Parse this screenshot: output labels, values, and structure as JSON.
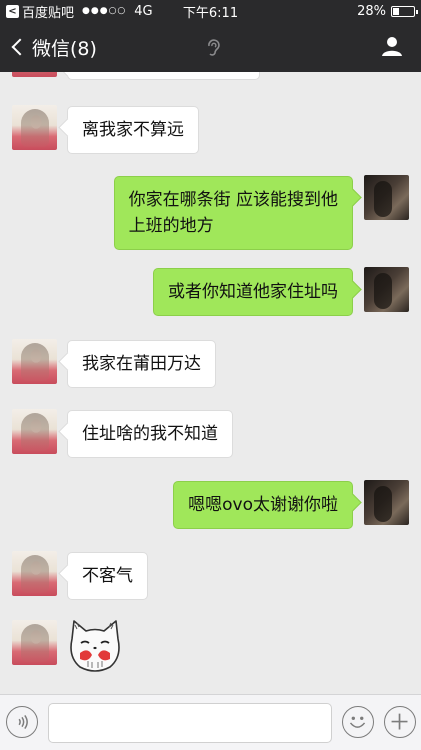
{
  "status_bar": {
    "back_app": "百度贴吧",
    "signal_dots": "●●●○○",
    "network": "4G",
    "time": "下午6:11",
    "battery_percent": "28%",
    "battery_level": 0.28
  },
  "nav": {
    "back_label": "微信(8)",
    "back_icon": "chevron-left-icon",
    "center_icon": "ear-icon",
    "right_icon": "person-icon"
  },
  "messages": [
    {
      "side": "in",
      "text": "离我家不算远"
    },
    {
      "side": "out",
      "text": "你家在哪条街 应该能搜到他\n上班的地方"
    },
    {
      "side": "out",
      "text": "或者你知道他家住址吗"
    },
    {
      "side": "in",
      "text": "我家在莆田万达"
    },
    {
      "side": "in",
      "text": "住址啥的我不知道"
    },
    {
      "side": "out",
      "text": "嗯嗯ovo太谢谢你啦"
    },
    {
      "side": "in",
      "text": "不客气"
    },
    {
      "side": "in",
      "sticker": "cat-sticker"
    }
  ],
  "colors": {
    "bar": "#2a2a2c",
    "chat_bg": "#ebebeb",
    "outgoing_bubble": "#a0e75a",
    "incoming_bubble": "#ffffff"
  },
  "input_bar": {
    "input_value": "",
    "left_icon": "voice-icon",
    "emoji_icon": "emoji-icon",
    "add_icon": "plus-icon"
  }
}
